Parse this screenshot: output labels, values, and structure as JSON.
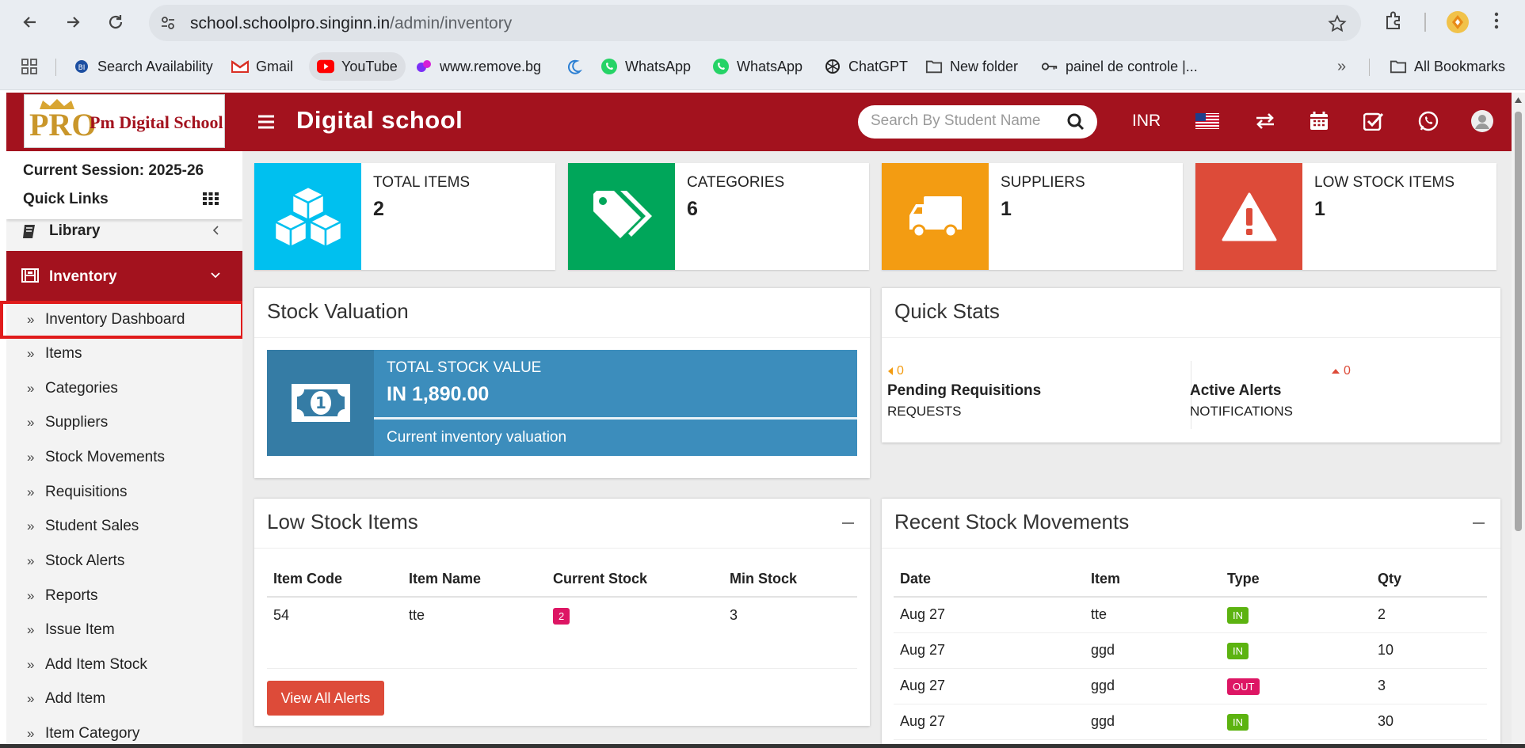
{
  "browser": {
    "url_host": "school.schoolpro.singinn.in",
    "url_path": "/admin/inventory",
    "bookmarks": [
      {
        "label": "Search Availability",
        "icon": "wrench-icon"
      },
      {
        "label": "Gmail",
        "icon": "gmail-icon"
      },
      {
        "label": "YouTube",
        "icon": "youtube-icon"
      },
      {
        "label": "www.remove.bg",
        "icon": "removebg-icon"
      },
      {
        "label": "",
        "icon": "moon-icon"
      },
      {
        "label": "WhatsApp",
        "icon": "whatsapp-icon"
      },
      {
        "label": "WhatsApp",
        "icon": "whatsapp-icon"
      },
      {
        "label": "ChatGPT",
        "icon": "chatgpt-icon"
      },
      {
        "label": "New folder",
        "icon": "folder-icon"
      },
      {
        "label": "painel de controle |...",
        "icon": "key-icon"
      }
    ],
    "all_bookmarks": "All Bookmarks"
  },
  "header": {
    "logo_pro": "PRO",
    "logo_text": "Pm Digital School",
    "title": "Digital school",
    "search_placeholder": "Search By Student Name",
    "currency": "INR",
    "accent": "#a3121e"
  },
  "sidebar": {
    "session": "Current Session: 2025-26",
    "quick_links": "Quick Links",
    "library": "Library",
    "inventory": "Inventory",
    "items": [
      "Inventory Dashboard",
      "Items",
      "Categories",
      "Suppliers",
      "Stock Movements",
      "Requisitions",
      "Student Sales",
      "Stock Alerts",
      "Reports",
      "Issue Item",
      "Add Item Stock",
      "Add Item",
      "Item Category"
    ]
  },
  "stats": [
    {
      "title": "TOTAL ITEMS",
      "value": "2",
      "color": "#00c0ef",
      "icon": "cubes-icon"
    },
    {
      "title": "CATEGORIES",
      "value": "6",
      "color": "#00a65a",
      "icon": "tags-icon"
    },
    {
      "title": "SUPPLIERS",
      "value": "1",
      "color": "#f39c12",
      "icon": "truck-icon"
    },
    {
      "title": "LOW STOCK ITEMS",
      "value": "1",
      "color": "#dd4b39",
      "icon": "warning-icon"
    }
  ],
  "valuation": {
    "title": "Stock Valuation",
    "box_title": "TOTAL STOCK VALUE",
    "amount": "IN 1,890.00",
    "description": "Current inventory valuation"
  },
  "quick_stats": {
    "title": "Quick Stats",
    "items": [
      {
        "change": "0",
        "label": "Pending Requisitions",
        "sub": "REQUESTS",
        "color": "#f39c12"
      },
      {
        "change": "0",
        "label": "Active Alerts",
        "sub": "NOTIFICATIONS",
        "color": "#dd4b39"
      }
    ]
  },
  "low_stock": {
    "title": "Low Stock Items",
    "columns": [
      "Item Code",
      "Item Name",
      "Current Stock",
      "Min Stock"
    ],
    "rows": [
      {
        "code": "54",
        "name": "tte",
        "current": "2",
        "min": "3"
      }
    ],
    "button": "View All Alerts"
  },
  "movements": {
    "title": "Recent Stock Movements",
    "columns": [
      "Date",
      "Item",
      "Type",
      "Qty"
    ],
    "rows": [
      {
        "date": "Aug 27",
        "item": "tte",
        "type": "IN",
        "qty": "2"
      },
      {
        "date": "Aug 27",
        "item": "ggd",
        "type": "IN",
        "qty": "10"
      },
      {
        "date": "Aug 27",
        "item": "ggd",
        "type": "OUT",
        "qty": "3"
      },
      {
        "date": "Aug 27",
        "item": "ggd",
        "type": "IN",
        "qty": "30"
      }
    ]
  }
}
